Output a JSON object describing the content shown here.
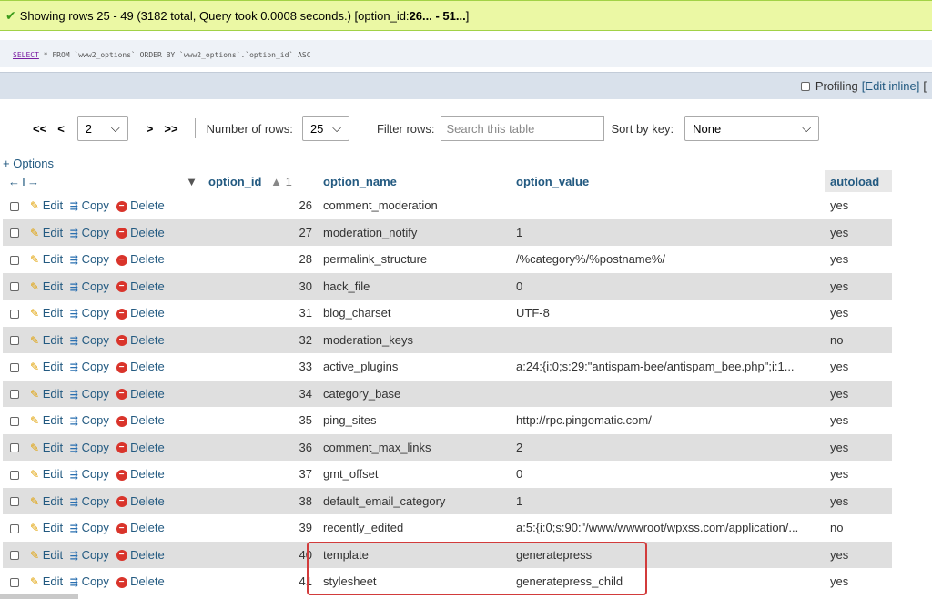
{
  "status": {
    "icon": "check-icon",
    "text_prefix": "Showing rows 25 - 49 (3182 total, Query took 0.0008 seconds.) [option_id: ",
    "range": "26... - 51...",
    "text_suffix": "]"
  },
  "sql": {
    "keyword": "SELECT",
    "rest": " * FROM `www2_options` ORDER BY `www2_options`.`option_id` ASC"
  },
  "profiling": {
    "label": "Profiling",
    "edit_inline": "[Edit inline]",
    "trailing": "["
  },
  "nav": {
    "first": "<<",
    "prev": "<",
    "page": "2",
    "next": ">",
    "last": ">>",
    "rows_label": "Number of rows:",
    "rows_value": "25",
    "filter_label": "Filter rows:",
    "filter_placeholder": "Search this table",
    "sort_label": "Sort by key:",
    "sort_value": "None"
  },
  "options_link": "+ Options",
  "table": {
    "header_arrows": "←T→",
    "headers": {
      "id": "option_id",
      "sort_marker": "▲ 1",
      "name": "option_name",
      "value": "option_value",
      "autoload": "autoload"
    },
    "actions": {
      "edit": "Edit",
      "copy": "Copy",
      "delete": "Delete"
    },
    "rows": [
      {
        "id": "26",
        "name": "comment_moderation",
        "value": "",
        "autoload": "yes"
      },
      {
        "id": "27",
        "name": "moderation_notify",
        "value": "1",
        "autoload": "yes"
      },
      {
        "id": "28",
        "name": "permalink_structure",
        "value": "/%category%/%postname%/",
        "autoload": "yes"
      },
      {
        "id": "30",
        "name": "hack_file",
        "value": "0",
        "autoload": "yes"
      },
      {
        "id": "31",
        "name": "blog_charset",
        "value": "UTF-8",
        "autoload": "yes"
      },
      {
        "id": "32",
        "name": "moderation_keys",
        "value": "",
        "autoload": "no"
      },
      {
        "id": "33",
        "name": "active_plugins",
        "value": "a:24:{i:0;s:29:\"antispam-bee/antispam_bee.php\";i:1...",
        "autoload": "yes"
      },
      {
        "id": "34",
        "name": "category_base",
        "value": "",
        "autoload": "yes"
      },
      {
        "id": "35",
        "name": "ping_sites",
        "value": "http://rpc.pingomatic.com/",
        "autoload": "yes"
      },
      {
        "id": "36",
        "name": "comment_max_links",
        "value": "2",
        "autoload": "yes"
      },
      {
        "id": "37",
        "name": "gmt_offset",
        "value": "0",
        "autoload": "yes"
      },
      {
        "id": "38",
        "name": "default_email_category",
        "value": "1",
        "autoload": "yes"
      },
      {
        "id": "39",
        "name": "recently_edited",
        "value": "a:5:{i:0;s:90:\"/www/wwwroot/wpxss.com/application/...",
        "autoload": "no"
      },
      {
        "id": "40",
        "name": "template",
        "value": "generatepress",
        "autoload": "yes"
      },
      {
        "id": "41",
        "name": "stylesheet",
        "value": "generatepress_child",
        "autoload": "yes"
      }
    ]
  },
  "colors": {
    "success_bg": "#ebf8a4",
    "link": "#235a81",
    "highlight_border": "#d23b3b",
    "row_alt": "#dfdfdf"
  }
}
